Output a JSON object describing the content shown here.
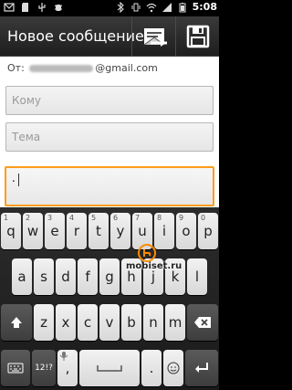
{
  "status": {
    "time": "5:08"
  },
  "title": {
    "text": "Новое сообщение"
  },
  "form": {
    "from_label": "От:",
    "from_email_domain": "@gmail.com",
    "to_placeholder": "Кому",
    "subject_placeholder": "Тема",
    "body_text": "."
  },
  "keyboard": {
    "row1": [
      "q",
      "w",
      "e",
      "r",
      "t",
      "y",
      "u",
      "i",
      "o",
      "p"
    ],
    "row2": [
      "a",
      "s",
      "d",
      "f",
      "g",
      "h",
      "j",
      "k",
      "l"
    ],
    "row3": [
      "z",
      "x",
      "c",
      "v",
      "b",
      "n",
      "m"
    ],
    "symbols_label": "12!?",
    "comma": ",",
    "period": "."
  },
  "watermark": "mobiset.ru",
  "colors": {
    "focus": "#ff9c1a",
    "titlebar": "#2a2a2a"
  }
}
